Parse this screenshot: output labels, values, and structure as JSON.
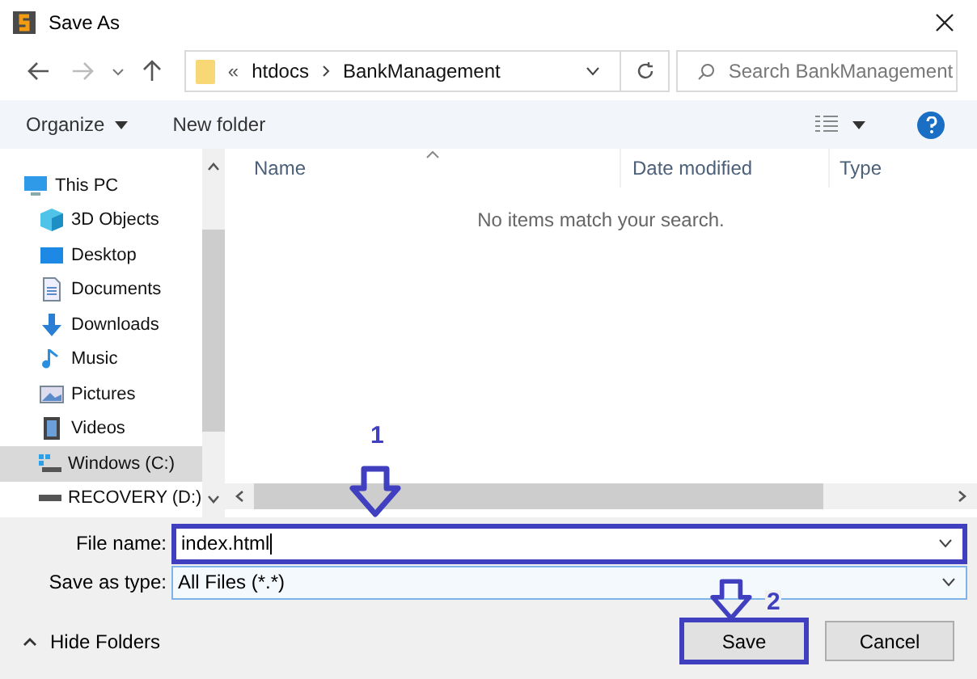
{
  "window": {
    "title": "Save As"
  },
  "address": {
    "overflow": "«",
    "crumbs": [
      "htdocs",
      "BankManagement"
    ]
  },
  "search": {
    "placeholder": "Search BankManagement"
  },
  "toolbar": {
    "organize": "Organize",
    "new_folder": "New folder"
  },
  "sidebar": {
    "items": [
      {
        "label": "This PC",
        "kind": "pc",
        "selected": false,
        "children": [
          {
            "label": "3D Objects",
            "kind": "cube",
            "selected": false
          },
          {
            "label": "Desktop",
            "kind": "desktop",
            "selected": false
          },
          {
            "label": "Documents",
            "kind": "document",
            "selected": false
          },
          {
            "label": "Downloads",
            "kind": "download",
            "selected": false
          },
          {
            "label": "Music",
            "kind": "music",
            "selected": false
          },
          {
            "label": "Pictures",
            "kind": "pictures",
            "selected": false
          },
          {
            "label": "Videos",
            "kind": "videos",
            "selected": false
          },
          {
            "label": "Windows (C:)",
            "kind": "system-drive",
            "selected": true
          },
          {
            "label": "RECOVERY (D:)",
            "kind": "drive",
            "selected": false
          }
        ]
      }
    ]
  },
  "table": {
    "columns": [
      "Name",
      "Date modified",
      "Type"
    ],
    "empty_message": "No items match your search."
  },
  "form": {
    "file_name_label": "File name:",
    "file_name": "index.html",
    "type_label": "Save as type:",
    "type": "All Files (*.*)"
  },
  "hide_folders": "Hide Folders",
  "buttons": [
    {
      "label": "Save",
      "kind": "primary"
    },
    {
      "label": "Cancel",
      "kind": "secondary"
    }
  ],
  "annotations": [
    {
      "label": "1"
    },
    {
      "label": "2"
    }
  ]
}
